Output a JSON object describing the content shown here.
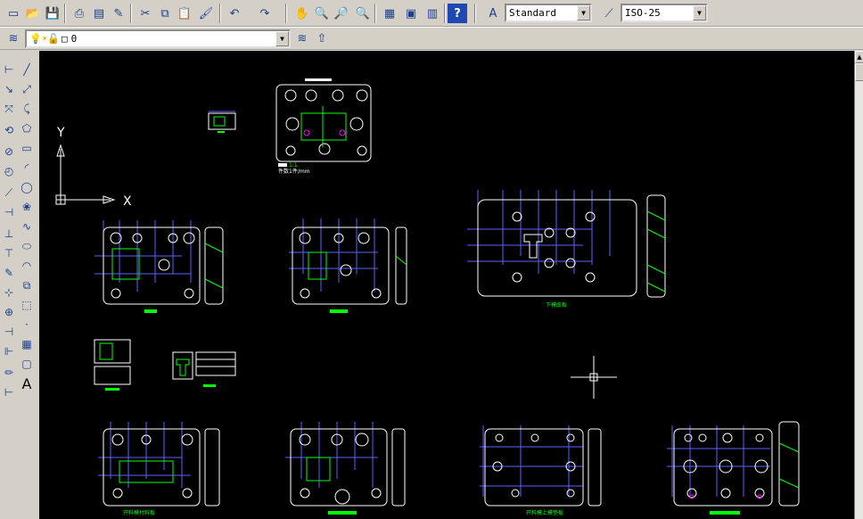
{
  "toolbar": {
    "text_style": "Standard",
    "dim_style": "ISO-25"
  },
  "layers": {
    "current_layer": "0"
  },
  "canvas": {
    "axis_x_label": "X",
    "axis_y_label": "Y",
    "label_lower_plate": "下模底板",
    "label_bottom_left": "开料模村料板",
    "label_bottom_mid": "开料模上模垫板",
    "legend_small": "1:1",
    "legend_small2": "件数1件/mm"
  },
  "colors": {
    "background": "#000000",
    "drawing_white": "#ffffff",
    "dimension_blue": "#6060ff",
    "magenta": "#ff00ff",
    "green": "#00ff00"
  }
}
